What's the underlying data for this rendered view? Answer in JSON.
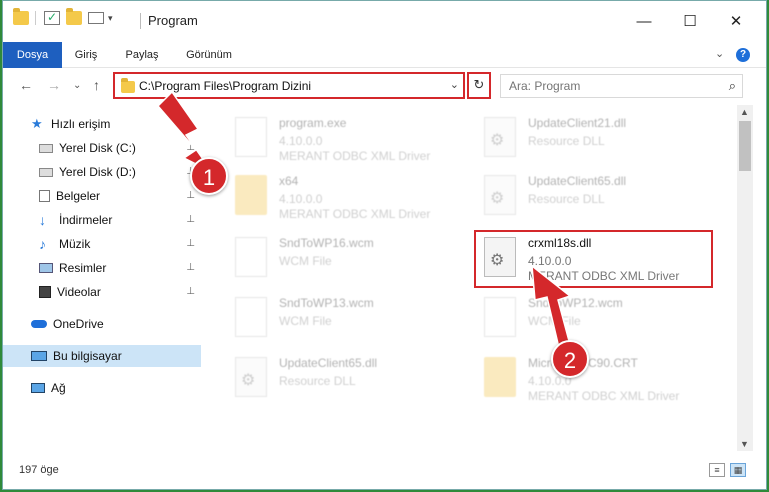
{
  "window": {
    "title": "Program",
    "minimize": "—",
    "maximize": "☐",
    "close": "✕"
  },
  "ribbon": {
    "tabs": [
      "Dosya",
      "Giriş",
      "Paylaş",
      "Görünüm"
    ],
    "expand": "⌄",
    "help": "?"
  },
  "address": {
    "path": "C:\\Program Files\\Program Dizini",
    "dropdown": "⌄",
    "refresh": "↻",
    "search_placeholder": "Ara: Program"
  },
  "nav": {
    "back": "←",
    "forward": "→",
    "recent": "⌄",
    "up": "↑"
  },
  "sidebar": {
    "items": [
      {
        "label": "Hızlı erişim",
        "icon": "star-icon"
      },
      {
        "label": "Yerel Disk (C:)",
        "icon": "drive-icon",
        "pinned": true
      },
      {
        "label": "Yerel Disk (D:)",
        "icon": "drive-icon",
        "pinned": true
      },
      {
        "label": "Belgeler",
        "icon": "document-icon",
        "pinned": true
      },
      {
        "label": "İndirmeler",
        "icon": "download-icon",
        "pinned": true
      },
      {
        "label": "Müzik",
        "icon": "music-icon",
        "pinned": true
      },
      {
        "label": "Resimler",
        "icon": "picture-icon",
        "pinned": true
      },
      {
        "label": "Videolar",
        "icon": "video-icon",
        "pinned": true
      },
      {
        "label": "OneDrive",
        "icon": "cloud-icon"
      },
      {
        "label": "Bu bilgisayar",
        "icon": "computer-icon",
        "selected": true
      },
      {
        "label": "Ağ",
        "icon": "network-icon"
      }
    ],
    "pin": "📌"
  },
  "files": [
    {
      "name": "program.exe",
      "line2": "4.10.0.0",
      "line3": "MERANT ODBC XML Driver",
      "kind": "exe"
    },
    {
      "name": "UpdateClient21.dll",
      "line2": "Resource DLL",
      "line3": "",
      "kind": "dll"
    },
    {
      "name": "x64",
      "line2": "4.10.0.0",
      "line3": "MERANT ODBC XML Driver",
      "kind": "folder"
    },
    {
      "name": "UpdateClient65.dll",
      "line2": "Resource DLL",
      "line3": "",
      "kind": "dll"
    },
    {
      "name": "SndToWP16.wcm",
      "line2": "WCM File",
      "line3": "",
      "kind": "file"
    },
    {
      "name": "crxml18s.dll",
      "line2": "4.10.0.0",
      "line3": "MERANT ODBC XML Driver",
      "kind": "dll",
      "highlighted": true
    },
    {
      "name": "SndToWP13.wcm",
      "line2": "WCM File",
      "line3": "",
      "kind": "file"
    },
    {
      "name": "SndToWP12.wcm",
      "line2": "WCM File",
      "line3": "",
      "kind": "file"
    },
    {
      "name": "UpdateClient65.dll",
      "line2": "Resource DLL",
      "line3": "",
      "kind": "dll"
    },
    {
      "name": "Microsoft.VC90.CRT",
      "line2": "4.10.0.0",
      "line3": "MERANT ODBC XML Driver",
      "kind": "folder"
    }
  ],
  "status": {
    "count": "197 öge"
  },
  "badges": [
    "1",
    "2"
  ],
  "colors": {
    "accent": "#1e5fbf",
    "highlight": "#d4282b",
    "selected": "#cce4f7"
  }
}
